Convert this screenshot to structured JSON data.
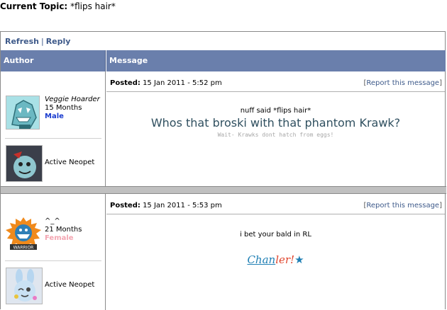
{
  "topic": {
    "label": "Current Topic:",
    "title": "*flips hair*"
  },
  "toolbar": {
    "refresh": "Refresh",
    "sep": "|",
    "reply": "Reply"
  },
  "headers": {
    "author": "Author",
    "message": "Message"
  },
  "posts": [
    {
      "user": {
        "name": "Veggie Hoarder",
        "age": "15 Months",
        "gender": "Male"
      },
      "pet_label": "Active Neopet",
      "posted_label": "Posted:",
      "date": "15 Jan 2011 - 5:52 pm",
      "report": {
        "open": "[",
        "link": "Report this message",
        "close": "]"
      },
      "body_line1": "nuff said *flips hair*",
      "body_line2": "Whos that broski with that phantom Krawk?",
      "body_line3": "Wait- Krawks dont hatch from eggs!"
    },
    {
      "user": {
        "name": "^_^",
        "age": "21 Months",
        "gender": "Female"
      },
      "pet_label": "Active Neopet",
      "posted_label": "Posted:",
      "date": "15 Jan 2011 - 5:53 pm",
      "report": {
        "open": "[",
        "link": "Report this message",
        "close": "]"
      },
      "body_line1": "i bet your bald in RL",
      "signature": {
        "part1": "Chan",
        "part2": "ler!",
        "star": "★"
      }
    }
  ],
  "colors": {
    "header_bg": "#6a7fac",
    "link": "#3e5a8a",
    "male": "#1a3ccf",
    "female": "#f4a6b2"
  }
}
